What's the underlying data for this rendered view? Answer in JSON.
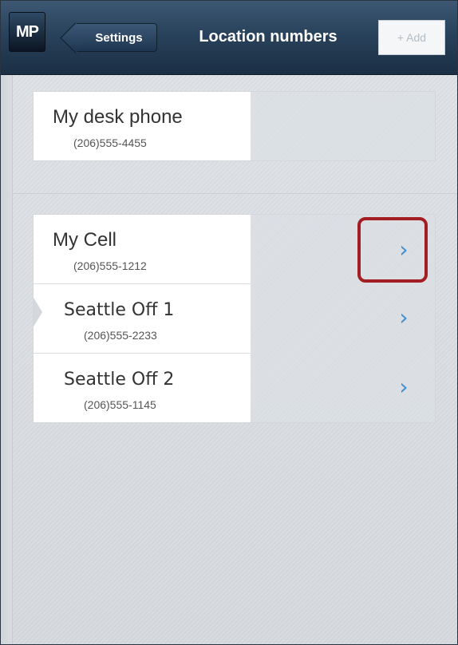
{
  "header": {
    "logo_text": "MP",
    "back_label": "Settings",
    "title": "Location numbers",
    "add_label": "+ Add"
  },
  "groups": [
    {
      "items": [
        {
          "name": "My desk phone",
          "phone": "(206)555-4455"
        }
      ]
    },
    {
      "items": [
        {
          "name": "My Cell",
          "phone": "(206)555-1212",
          "chevron": "›"
        },
        {
          "name": "Seattle Off 1",
          "phone": "(206)555-2233",
          "chevron": "›"
        },
        {
          "name": "Seattle Off 2",
          "phone": "(206)555-1145",
          "chevron": "›"
        }
      ]
    }
  ],
  "colors": {
    "header_top": "#3d5873",
    "header_bottom": "#1b2f44",
    "chevron": "#3d8fd0",
    "highlight": "#a31e23",
    "background": "#dfe3e7"
  },
  "icons": {
    "logo": "mp-logo-icon",
    "chevron": "chevron-right-icon",
    "back": "back-arrow-icon"
  }
}
